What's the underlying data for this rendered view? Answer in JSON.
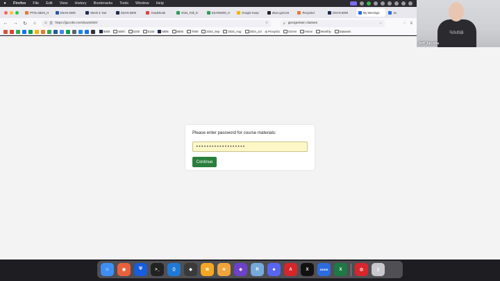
{
  "menubar": {
    "app_name": "Firefox",
    "items": [
      "File",
      "Edit",
      "View",
      "History",
      "Bookmarks",
      "Tools",
      "Window",
      "Help"
    ]
  },
  "tabs": [
    {
      "label": "FFOLABSS_H",
      "color": "#e07b39"
    },
    {
      "label": "DSAN 5000",
      "color": "#1f5aa6"
    },
    {
      "label": "Week 3: Nor",
      "color": "#1f2b4d"
    },
    {
      "label": "DSAN 5000",
      "color": "#1f2b4d"
    },
    {
      "label": "Gradebook",
      "color": "#d9453b"
    },
    {
      "label": "2024_Fall_G",
      "color": "#2e9b56"
    },
    {
      "label": "DSAN5000_H",
      "color": "#2e9b56"
    },
    {
      "label": "Google Keep",
      "color": "#f4b400"
    },
    {
      "label": "dsan-gu/cont",
      "color": "#222222"
    },
    {
      "label": "Recycled",
      "color": "#e07b39"
    },
    {
      "label": "DSAN 5000",
      "color": "#1f2b4d"
    },
    {
      "label": "My Meetings",
      "color": "#2d6cdf"
    },
    {
      "label": "Ja",
      "color": "#2d6cdf"
    }
  ],
  "active_tab_index": 11,
  "navbar": {
    "url": "https://jjacobs.me/dsan5000/",
    "search_text": "georgetown classes"
  },
  "bookmarks": [
    {
      "label": "5000",
      "icon": "square"
    },
    {
      "label": "5000",
      "icon": "folder"
    },
    {
      "label": "5100",
      "icon": "folder"
    },
    {
      "label": "5150",
      "icon": "folder"
    },
    {
      "label": "6805",
      "icon": "square"
    },
    {
      "label": "6805",
      "icon": "folder"
    },
    {
      "label": "7000",
      "icon": "folder"
    },
    {
      "label": "2024_Sep",
      "icon": "folder"
    },
    {
      "label": "2024_Aug",
      "icon": "folder"
    },
    {
      "label": "2024_Jul",
      "icon": "folder"
    },
    {
      "label": "ProxyGU",
      "icon": "globe"
    },
    {
      "label": "DSAN",
      "icon": "folder"
    },
    {
      "label": "Home",
      "icon": "folder"
    },
    {
      "label": "Monthly",
      "icon": "folder"
    },
    {
      "label": "Datasets",
      "icon": "folder"
    }
  ],
  "password_form": {
    "label": "Please enter password for course materials:",
    "masked_value": "•••••••••••••••••••",
    "button_label": "Continue"
  },
  "webcam": {
    "name": "Jeff Jacobs"
  },
  "dock": {
    "apps": [
      {
        "name": "finder-icon",
        "color": "#3f8ff2",
        "glyph": "☺"
      },
      {
        "name": "firefox-icon",
        "color": "#e8613c",
        "glyph": "◉"
      },
      {
        "name": "bitwarden-icon",
        "color": "#175ddc",
        "glyph": "⛨"
      },
      {
        "name": "terminal-icon",
        "color": "#222222",
        "glyph": ">_"
      },
      {
        "name": "vscode-icon",
        "color": "#1f7ad6",
        "glyph": "⟨⟩"
      },
      {
        "name": "github-icon",
        "color": "#3a3a3a",
        "glyph": "◆"
      },
      {
        "name": "photos-icon",
        "color": "#f5a623",
        "glyph": "✿"
      },
      {
        "name": "tableplus-icon",
        "color": "#f2a33a",
        "glyph": "≋"
      },
      {
        "name": "obsidian-icon",
        "color": "#6d42c9",
        "glyph": "◆"
      },
      {
        "name": "rstudio-icon",
        "color": "#75aadb",
        "glyph": "R"
      },
      {
        "name": "discord-icon",
        "color": "#5865f2",
        "glyph": "☻"
      },
      {
        "name": "acrobat-icon",
        "color": "#d4262b",
        "glyph": "A"
      },
      {
        "name": "x-icon",
        "color": "#111111",
        "glyph": "X"
      },
      {
        "name": "zoom-icon",
        "color": "#2d6cdf",
        "glyph": "zoom"
      },
      {
        "name": "excel-icon",
        "color": "#1d7a45",
        "glyph": "X"
      },
      {
        "name": "screen-record-icon",
        "color": "#d8262c",
        "glyph": "◎"
      },
      {
        "name": "trash-icon",
        "color": "#c9c9cc",
        "glyph": "▯"
      }
    ]
  }
}
